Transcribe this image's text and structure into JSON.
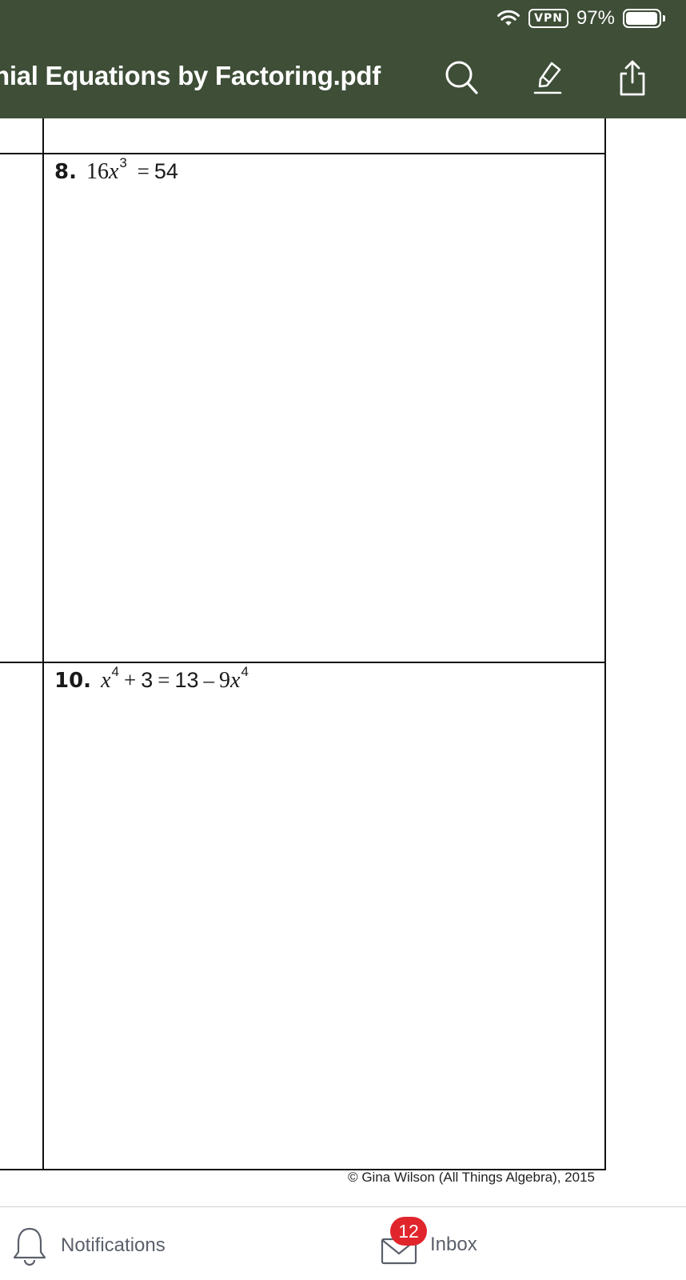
{
  "status_bar": {
    "vpn_label": "VPN",
    "battery_percent": "97%",
    "battery_level": 0.97,
    "wifi_icon": "wifi-icon"
  },
  "header": {
    "title": "nial Equations by Factoring.pdf",
    "background_color": "#3e4e37",
    "actions": [
      {
        "name": "search",
        "icon": "search-icon"
      },
      {
        "name": "annotate",
        "icon": "highlighter-icon"
      },
      {
        "name": "share",
        "icon": "share-icon"
      }
    ]
  },
  "worksheet": {
    "problems": [
      {
        "number": "8.",
        "equation": "16x³ = 54"
      },
      {
        "number": "10.",
        "equation": "x⁴ + 3 = 13 – 9x⁴"
      }
    ],
    "footer": "© Gina Wilson (All Things Algebra), 2015"
  },
  "tab_bar": {
    "notifications_label": "Notifications",
    "inbox_label": "Inbox",
    "inbox_badge": "12",
    "badge_color": "#e0262c"
  }
}
